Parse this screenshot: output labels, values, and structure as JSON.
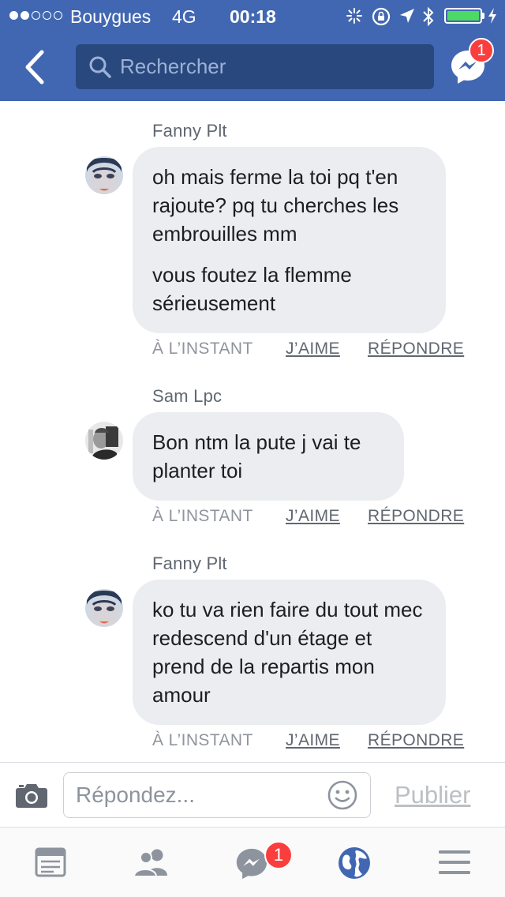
{
  "status_bar": {
    "carrier": "Bouygues",
    "network": "4G",
    "time": "00:18",
    "signal_bars_filled": 2,
    "signal_bars_total": 5,
    "battery_level": 1.0
  },
  "header": {
    "search_placeholder": "Rechercher",
    "messenger_badge": "1"
  },
  "comments": [
    {
      "author": "Fanny Plt",
      "paragraphs": [
        "oh mais ferme la toi pq t'en rajoute? pq tu cherches les embrouilles mm",
        "vous foutez la flemme sérieusement"
      ],
      "time": "À L’INSTANT",
      "like_label": "J’AIME",
      "reply_label": "RÉPONDRE"
    },
    {
      "author": "Sam Lpc",
      "paragraphs": [
        "Bon ntm la pute j vai te planter toi"
      ],
      "time": "À L’INSTANT",
      "like_label": "J’AIME",
      "reply_label": "RÉPONDRE"
    },
    {
      "author": "Fanny Plt",
      "paragraphs": [
        "ko tu va rien faire du tout mec redescend d'un étage et prend de la repartis mon amour"
      ],
      "time": "À L’INSTANT",
      "like_label": "J’AIME",
      "reply_label": "RÉPONDRE"
    }
  ],
  "composer": {
    "placeholder": "Répondez...",
    "publish_label": "Publier"
  },
  "tab_bar": {
    "items": [
      "news-feed-icon",
      "friends-icon",
      "messenger-icon",
      "notifications-globe-icon",
      "menu-icon"
    ],
    "messenger_badge": "1"
  },
  "colors": {
    "header_bg": "#4267b2",
    "search_bg": "#29487d",
    "bubble_bg": "#ebedf0",
    "badge_red": "#fa3e3e",
    "battery_green": "#4cd964"
  }
}
